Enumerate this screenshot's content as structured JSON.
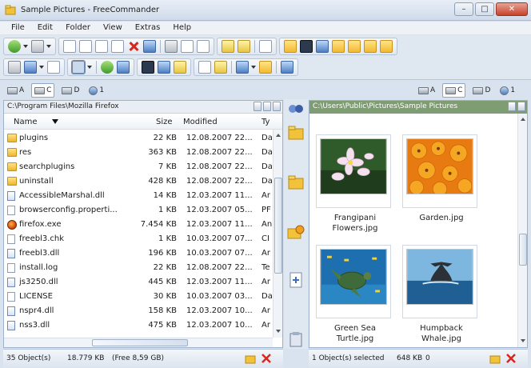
{
  "window": {
    "title": "Sample Pictures - FreeCommander",
    "min": "–",
    "max": "□",
    "close": "✕"
  },
  "menu": [
    "File",
    "Edit",
    "Folder",
    "View",
    "Extras",
    "Help"
  ],
  "drives_left": [
    {
      "label": "A",
      "active": false
    },
    {
      "label": "C",
      "active": true
    },
    {
      "label": "D",
      "active": false
    },
    {
      "label": "1",
      "active": false,
      "network": true
    }
  ],
  "drives_right": [
    {
      "label": "A",
      "active": false
    },
    {
      "label": "C",
      "active": true
    },
    {
      "label": "D",
      "active": false
    },
    {
      "label": "1",
      "active": false,
      "network": true
    }
  ],
  "left_panel": {
    "path": "C:\\Program Files\\Mozilla Firefox",
    "columns": {
      "name": "Name",
      "size": "Size",
      "modified": "Modified",
      "type": "Ty"
    },
    "files": [
      {
        "name": "plugins",
        "size": "22 KB",
        "modified": "12.08.2007 22...",
        "type": "Da",
        "kind": "folder"
      },
      {
        "name": "res",
        "size": "363 KB",
        "modified": "12.08.2007 22...",
        "type": "Da",
        "kind": "folder"
      },
      {
        "name": "searchplugins",
        "size": "7 KB",
        "modified": "12.08.2007 22...",
        "type": "Da",
        "kind": "folder"
      },
      {
        "name": "uninstall",
        "size": "428 KB",
        "modified": "12.08.2007 22...",
        "type": "Da",
        "kind": "folder"
      },
      {
        "name": "AccessibleMarshal.dll",
        "size": "14 KB",
        "modified": "12.03.2007 11...",
        "type": "Ar",
        "kind": "dll"
      },
      {
        "name": "browserconfig.properti...",
        "size": "1 KB",
        "modified": "12.03.2007 05...",
        "type": "PF",
        "kind": "file"
      },
      {
        "name": "firefox.exe",
        "size": "7.454 KB",
        "modified": "12.03.2007 11...",
        "type": "An",
        "kind": "exe"
      },
      {
        "name": "freebl3.chk",
        "size": "1 KB",
        "modified": "10.03.2007 07...",
        "type": "CI",
        "kind": "file"
      },
      {
        "name": "freebl3.dll",
        "size": "196 KB",
        "modified": "10.03.2007 07...",
        "type": "Ar",
        "kind": "dll"
      },
      {
        "name": "install.log",
        "size": "22 KB",
        "modified": "12.08.2007 22...",
        "type": "Te",
        "kind": "file"
      },
      {
        "name": "js3250.dll",
        "size": "445 KB",
        "modified": "12.03.2007 11...",
        "type": "Ar",
        "kind": "dll"
      },
      {
        "name": "LICENSE",
        "size": "30 KB",
        "modified": "10.03.2007 03...",
        "type": "Da",
        "kind": "file"
      },
      {
        "name": "nspr4.dll",
        "size": "158 KB",
        "modified": "12.03.2007 10...",
        "type": "Ar",
        "kind": "dll"
      },
      {
        "name": "nss3.dll",
        "size": "475 KB",
        "modified": "12.03.2007 10...",
        "type": "Ar",
        "kind": "dll"
      }
    ],
    "status_count": "35 Object(s)",
    "status_size": "18.779 KB",
    "status_free": "(Free 8,59 GB)"
  },
  "right_panel": {
    "path": "C:\\Users\\Public\\Pictures\\Sample Pictures",
    "thumbnails": [
      {
        "name": "Frangipani Flowers.jpg",
        "line1": "Frangipani",
        "line2": "Flowers.jpg",
        "scene": "flowers"
      },
      {
        "name": "Garden.jpg",
        "line1": "Garden.jpg",
        "line2": "",
        "scene": "garden"
      },
      {
        "name": "Green Sea Turtle.jpg",
        "line1": "Green Sea",
        "line2": "Turtle.jpg",
        "scene": "turtle"
      },
      {
        "name": "Humpback Whale.jpg",
        "line1": "Humpback",
        "line2": "Whale.jpg",
        "scene": "whale"
      }
    ],
    "status_selected": "1 Object(s) selected",
    "status_size": "648 KB",
    "status_extra": "0"
  },
  "colors": {
    "active_path_bg": "#7f9d72",
    "inactive_path_bg": "#e9eef5",
    "window_bg": "#d9e3ef"
  }
}
